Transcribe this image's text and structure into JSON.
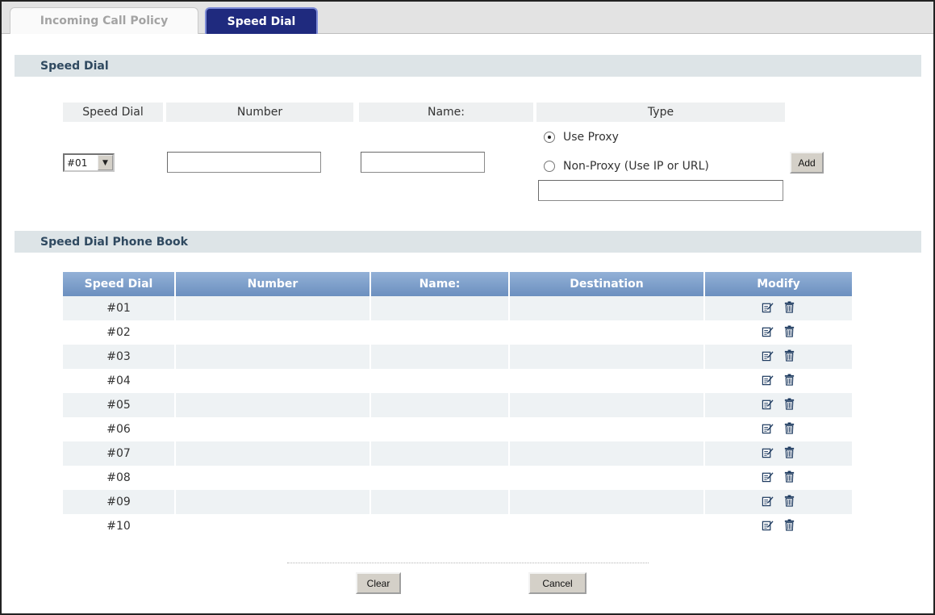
{
  "tabs": [
    {
      "label": "Incoming Call Policy",
      "active": false
    },
    {
      "label": "Speed Dial",
      "active": true
    }
  ],
  "speed_dial_section": {
    "title": "Speed Dial",
    "headers": {
      "speed_dial": "Speed Dial",
      "number": "Number",
      "name": "Name:",
      "type": "Type"
    },
    "select_value": "#01",
    "radio_use_proxy": "Use Proxy",
    "radio_non_proxy": "Non-Proxy (Use IP or URL)",
    "add_button": "Add"
  },
  "phone_book": {
    "title": "Speed Dial Phone Book",
    "columns": [
      "Speed Dial",
      "Number",
      "Name:",
      "Destination",
      "Modify"
    ],
    "rows": [
      {
        "speed_dial": "#01",
        "number": "",
        "name": "",
        "destination": ""
      },
      {
        "speed_dial": "#02",
        "number": "",
        "name": "",
        "destination": ""
      },
      {
        "speed_dial": "#03",
        "number": "",
        "name": "",
        "destination": ""
      },
      {
        "speed_dial": "#04",
        "number": "",
        "name": "",
        "destination": ""
      },
      {
        "speed_dial": "#05",
        "number": "",
        "name": "",
        "destination": ""
      },
      {
        "speed_dial": "#06",
        "number": "",
        "name": "",
        "destination": ""
      },
      {
        "speed_dial": "#07",
        "number": "",
        "name": "",
        "destination": ""
      },
      {
        "speed_dial": "#08",
        "number": "",
        "name": "",
        "destination": ""
      },
      {
        "speed_dial": "#09",
        "number": "",
        "name": "",
        "destination": ""
      },
      {
        "speed_dial": "#10",
        "number": "",
        "name": "",
        "destination": ""
      }
    ],
    "icons": {
      "edit": "edit-icon",
      "delete": "trash-icon"
    }
  },
  "footer": {
    "clear_button": "Clear",
    "cancel_button": "Cancel"
  },
  "colors": {
    "active_tab": "#1f2a7e",
    "section_bar": "#dde4e7",
    "table_header": "#7c9ccb"
  }
}
